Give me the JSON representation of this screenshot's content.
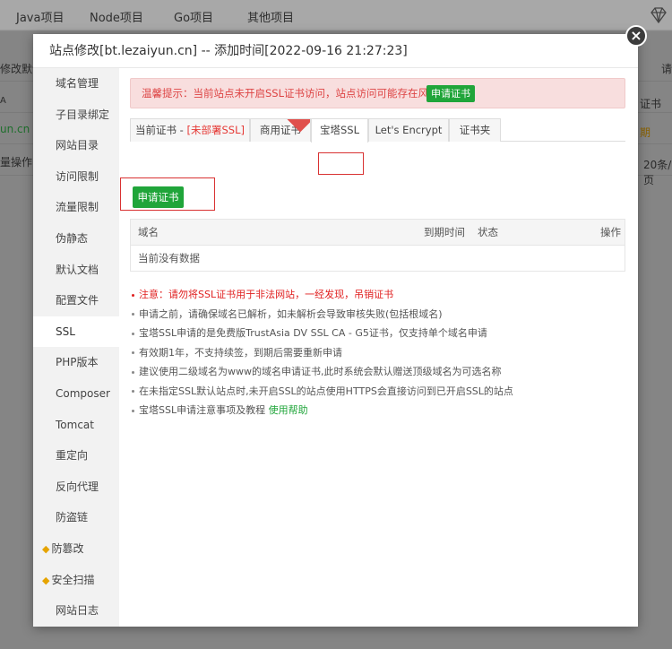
{
  "background": {
    "nav": [
      "Java项目",
      "Node项目",
      "Go项目",
      "其他项目"
    ],
    "left_fragments": [
      "修改默认",
      "A",
      "un.cn",
      "量操作"
    ],
    "right_fragments": [
      "请",
      "证书",
      "期",
      "20条/页"
    ]
  },
  "dialog": {
    "title": "站点修改[bt.lezaiyun.cn] -- 添加时间[2022-09-16 21:27:23]",
    "close_glyph": "×"
  },
  "sidebar": {
    "items": [
      {
        "label": "域名管理"
      },
      {
        "label": "子目录绑定"
      },
      {
        "label": "网站目录"
      },
      {
        "label": "访问限制"
      },
      {
        "label": "流量限制"
      },
      {
        "label": "伪静态"
      },
      {
        "label": "默认文档"
      },
      {
        "label": "配置文件"
      },
      {
        "label": "SSL"
      },
      {
        "label": "PHP版本"
      },
      {
        "label": "Composer"
      },
      {
        "label": "Tomcat"
      },
      {
        "label": "重定向"
      },
      {
        "label": "反向代理"
      },
      {
        "label": "防盗链"
      },
      {
        "label": "防篡改"
      },
      {
        "label": "安全扫描"
      },
      {
        "label": "网站日志"
      }
    ],
    "active": "SSL"
  },
  "warning": {
    "text": "温馨提示：当前站点未开启SSL证书访问，站点访问可能存在风险。",
    "button": "申请证书"
  },
  "tabs": {
    "current_prefix": "当前证书 - ",
    "current_status": "[未部署SSL]",
    "commercial": "商用证书",
    "baota": "宝塔SSL",
    "letsencrypt": "Let's Encrypt",
    "folder": "证书夹"
  },
  "apply_button": "申请证书",
  "table": {
    "columns": [
      "域名",
      "到期时间",
      "状态",
      "操作"
    ],
    "empty": "当前没有数据"
  },
  "notes": [
    {
      "text": "注意：请勿将SSL证书用于非法网站，一经发现，吊销证书",
      "danger": true
    },
    {
      "text": "申请之前，请确保域名已解析，如未解析会导致审核失败(包括根域名)"
    },
    {
      "text": "宝塔SSL申请的是免费版TrustAsia DV SSL CA - G5证书，仅支持单个域名申请"
    },
    {
      "text": "有效期1年，不支持续签，到期后需要重新申请"
    },
    {
      "text": "建议使用二级域名为www的域名申请证书,此时系统会默认赠送顶级域名为可选名称"
    },
    {
      "text": "在未指定SSL默认站点时,未开启SSL的站点使用HTTPS会直接访问到已开启SSL的站点"
    },
    {
      "text": "宝塔SSL申请注意事项及教程 ",
      "link": "使用帮助"
    }
  ],
  "colors": {
    "accent_green": "#20a53a",
    "danger_red": "#e02020",
    "warning_bg": "#f8dede"
  }
}
